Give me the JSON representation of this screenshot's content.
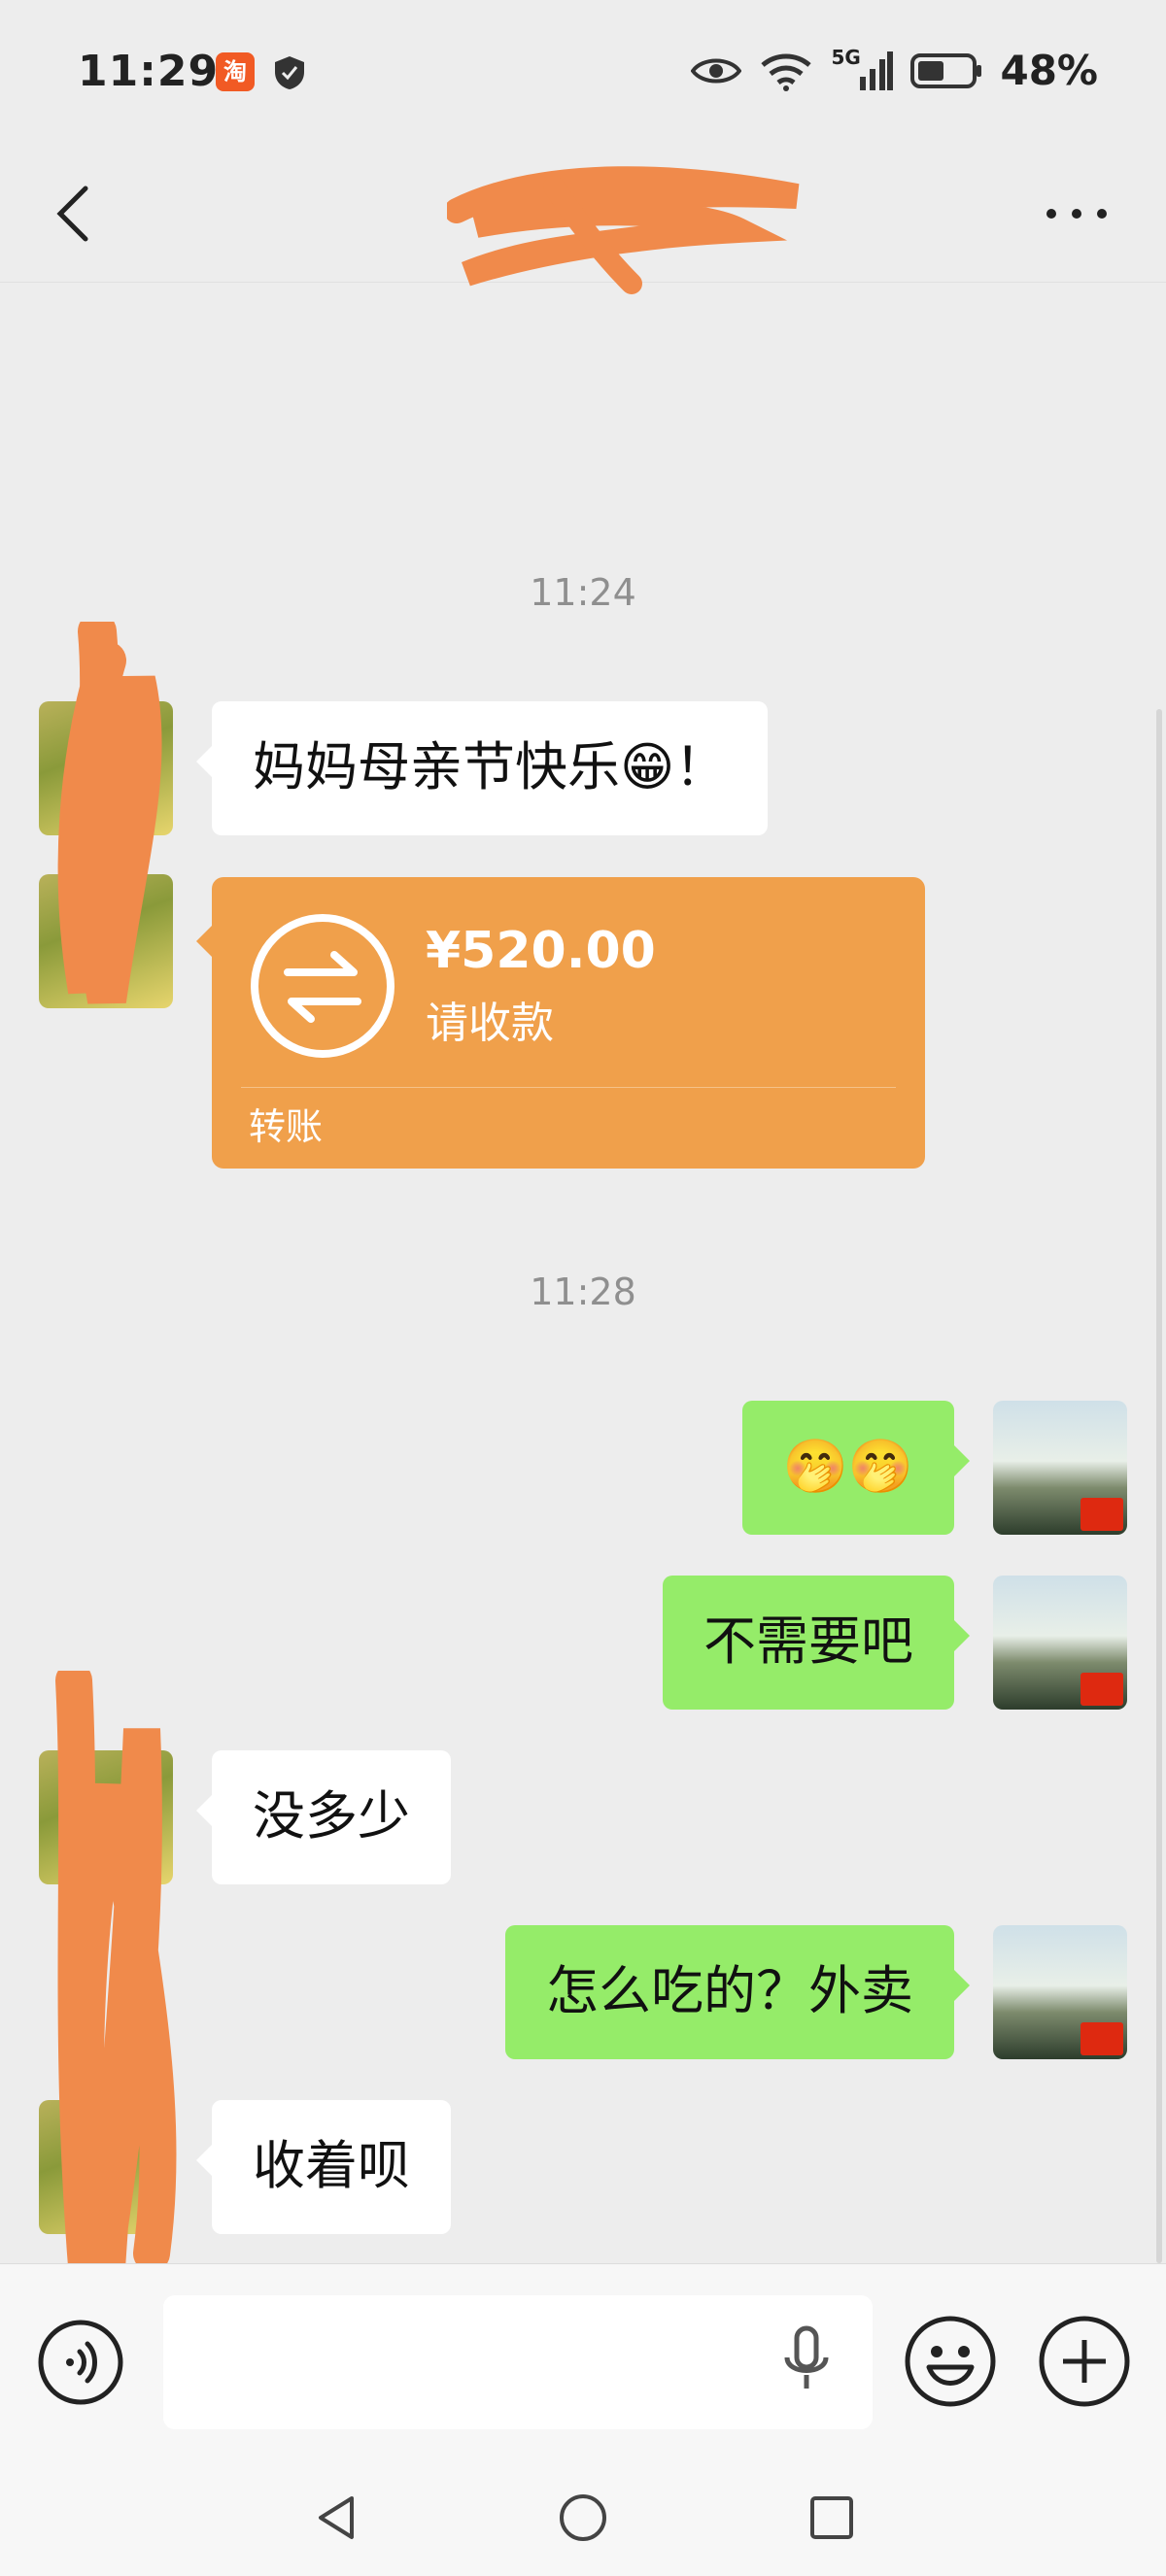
{
  "status_bar": {
    "time": "11:29",
    "app_icon_glyph": "淘",
    "battery": "48%",
    "network": "5G",
    "icons": [
      "taobao-icon",
      "shield-icon",
      "eye-icon",
      "wifi-icon",
      "signal-icon",
      "battery-icon"
    ]
  },
  "header": {
    "title": "",
    "back_icon": "chevron-left-icon",
    "more_icon": "more-dots-icon"
  },
  "chat": {
    "timestamps": [
      "11:24",
      "11:28"
    ],
    "messages": [
      {
        "side": "in",
        "text": "妈妈母亲节快乐😁！"
      },
      {
        "side": "out",
        "text": "🤭🤭"
      },
      {
        "side": "out",
        "text": "不需要吧"
      },
      {
        "side": "in",
        "text": "没多少"
      },
      {
        "side": "out",
        "text": "怎么吃的？外卖"
      },
      {
        "side": "in",
        "text": "收着呗"
      }
    ],
    "transfer": {
      "amount": "¥520.00",
      "note": "请收款",
      "label": "转账",
      "icon": "transfer-arrows-icon"
    }
  },
  "input_bar": {
    "placeholder": "",
    "icons": [
      "voice-icon",
      "mic-icon",
      "emoji-icon",
      "plus-icon"
    ]
  },
  "nav_bar": {
    "icons": [
      "nav-back-icon",
      "nav-home-icon",
      "nav-recent-icon"
    ]
  },
  "colors": {
    "background": "#ededed",
    "outgoing_bubble": "#95ec69",
    "incoming_bubble": "#ffffff",
    "transfer": "#f0a04b",
    "redaction": "#f08a4b"
  }
}
